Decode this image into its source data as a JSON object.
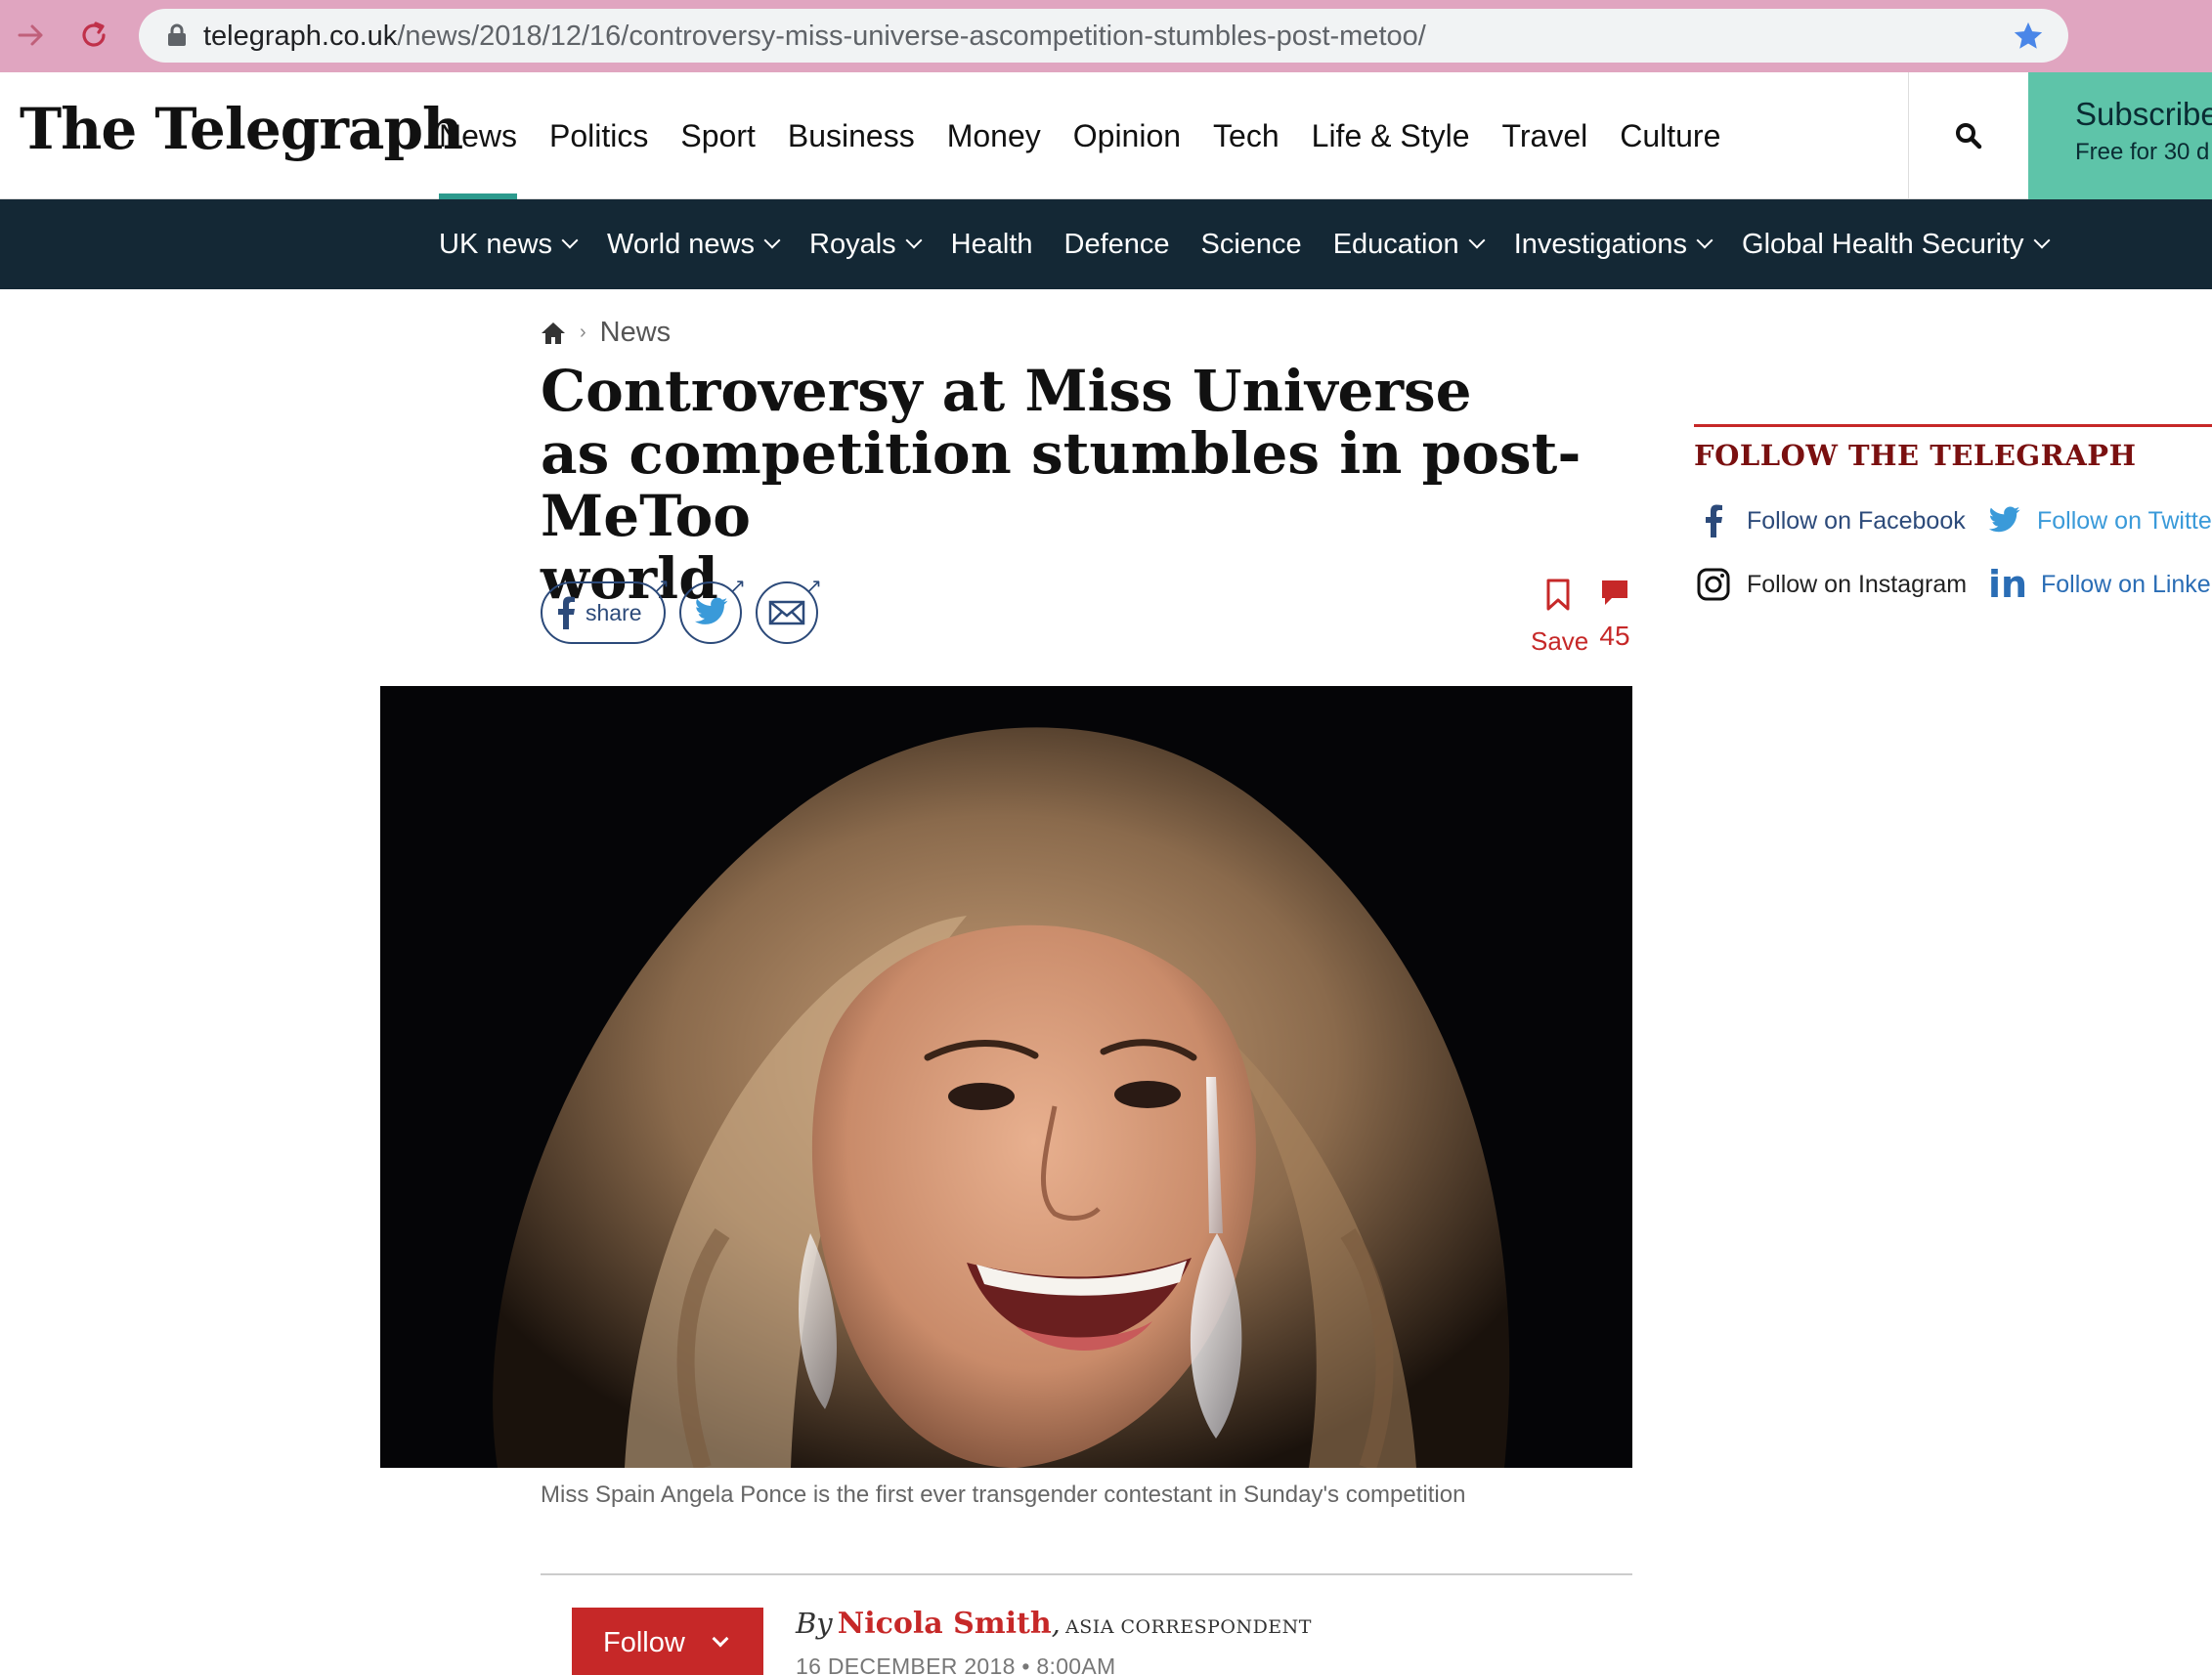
{
  "browser": {
    "url_host": "telegraph.co.uk",
    "url_path": "/news/2018/12/16/controversy-miss-universe-ascompetition-stumbles-post-metoo/"
  },
  "masthead": {
    "logo": "The Telegraph",
    "nav": [
      "News",
      "Politics",
      "Sport",
      "Business",
      "Money",
      "Opinion",
      "Tech",
      "Life & Style",
      "Travel",
      "Culture"
    ],
    "subscribe_title": "Subscribe",
    "subscribe_sub": "Free for 30 d"
  },
  "subnav": [
    {
      "label": "UK news",
      "dropdown": true
    },
    {
      "label": "World news",
      "dropdown": true
    },
    {
      "label": "Royals",
      "dropdown": true
    },
    {
      "label": "Health",
      "dropdown": false
    },
    {
      "label": "Defence",
      "dropdown": false
    },
    {
      "label": "Science",
      "dropdown": false
    },
    {
      "label": "Education",
      "dropdown": true
    },
    {
      "label": "Investigations",
      "dropdown": true
    },
    {
      "label": "Global Health Security",
      "dropdown": true
    }
  ],
  "article": {
    "breadcrumb": "News",
    "headline_line1": "Controversy at Miss Universe",
    "headline_line2": "as competition stumbles in post-MeToo",
    "headline_line3": "world",
    "share_label": "share",
    "save_label": "Save",
    "comment_count": "45",
    "caption": "Miss Spain Angela Ponce is the first ever transgender contestant in Sunday's competition",
    "follow_label": "Follow",
    "byline_by": "By",
    "author": "Nicola Smith",
    "role": "ASIA CORRESPONDENT",
    "date": "16 DECEMBER 2018 • 8:00AM"
  },
  "follow_panel": {
    "title": "FOLLOW THE TELEGRAPH",
    "facebook": "Follow on Facebook",
    "twitter": "Follow on Twitte",
    "instagram": "Follow on Instagram",
    "linkedin": "Follow on Linke"
  },
  "colors": {
    "chrome": "#e0a5c0",
    "subnav_bg": "#142835",
    "accent_red": "#c62828",
    "subscribe_bg": "#5ec4a9",
    "active_tab": "#2c9a8d"
  }
}
